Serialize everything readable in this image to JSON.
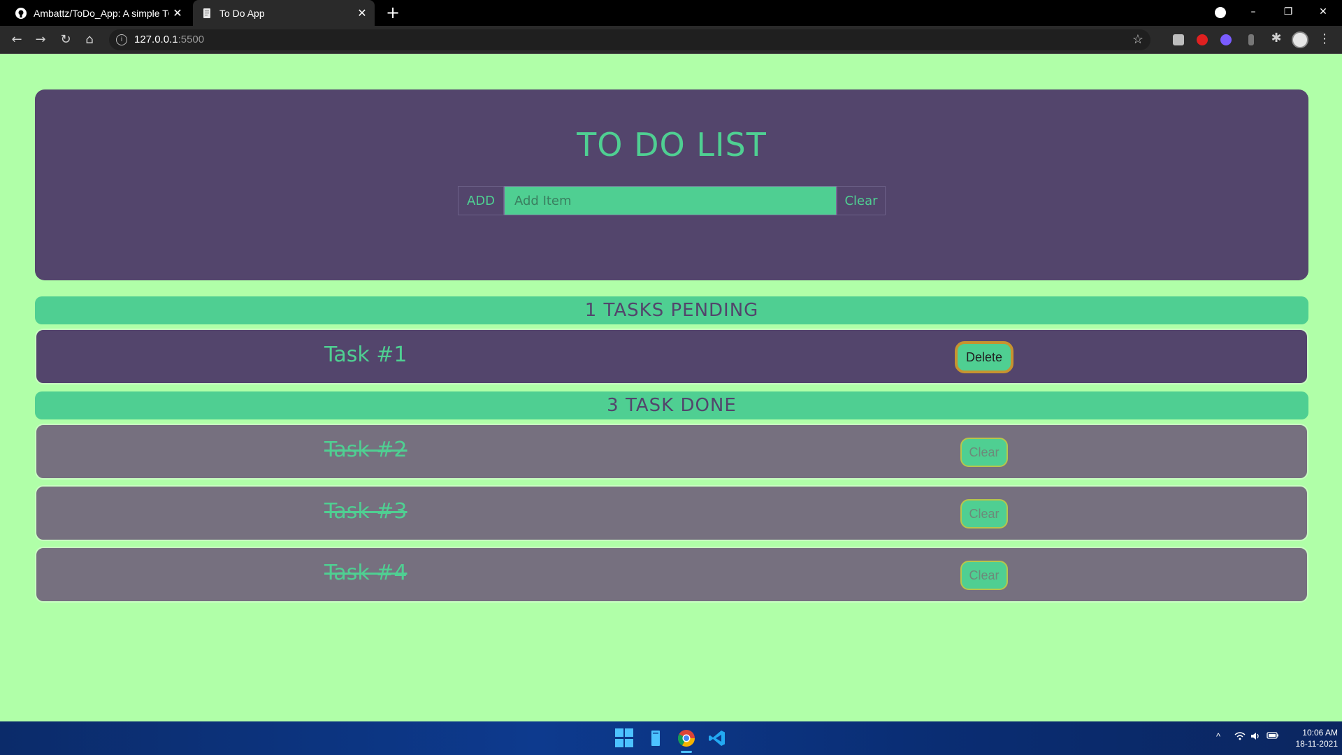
{
  "browser": {
    "tabs": [
      {
        "title": "Ambattz/ToDo_App: A simple TO",
        "favicon": "github-icon",
        "active": false
      },
      {
        "title": "To Do App",
        "favicon": "page-icon",
        "active": true
      }
    ],
    "new_tab": "+",
    "url_host": "127.0.0.1",
    "url_port": ":5500",
    "window_controls": {
      "minimize": "–",
      "restore": "❐",
      "close": "✕"
    }
  },
  "app": {
    "title": "TO DO LIST",
    "add_button": "ADD",
    "input_placeholder": "Add Item",
    "input_value": "",
    "clear_button": "Clear",
    "pending_header": "1 TASKS PENDING",
    "done_header": "3 TASK DONE",
    "pending": [
      {
        "name": "Task #1",
        "action": "Delete"
      }
    ],
    "done": [
      {
        "name": "Task #2",
        "action": "Clear"
      },
      {
        "name": "Task #3",
        "action": "Clear"
      },
      {
        "name": "Task #4",
        "action": "Clear"
      }
    ],
    "colors": {
      "background": "#b0ffa8",
      "card": "#53456c",
      "accent": "#4fcf92",
      "done_card": "#76707f"
    }
  },
  "taskbar": {
    "time": "10:06 AM",
    "date": "18-11-2021",
    "tray_chevron": "^"
  }
}
